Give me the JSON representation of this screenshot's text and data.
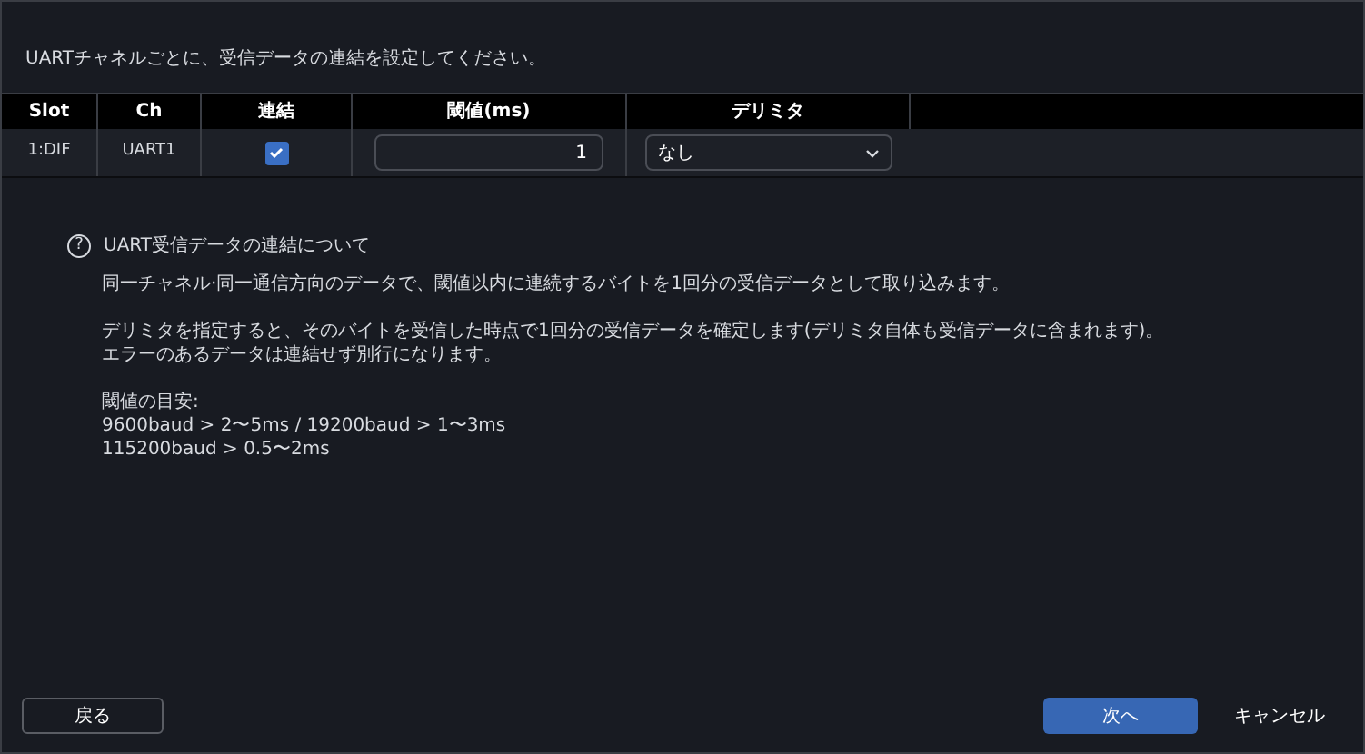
{
  "instruction": "UARTチャネルごとに、受信データの連結を設定してください。",
  "table": {
    "columns": [
      "Slot",
      "Ch",
      "連結",
      "閾値(ms)",
      "デリミタ"
    ],
    "rows": [
      {
        "slot": "1:DIF",
        "ch": "UART1",
        "checked": true,
        "threshold": "1",
        "delimiter": "なし"
      }
    ]
  },
  "info": {
    "icon": "?",
    "title": "UART受信データの連結について",
    "paragraphs": [
      [
        "同一チャネル·同一通信方向のデータで、閾値以内に連続するバイトを1回分の受信データとして取り込みます。"
      ],
      [
        "デリミタを指定すると、そのバイトを受信した時点で1回分の受信データを確定します(デリミタ自体も受信データに含まれます)。",
        "エラーのあるデータは連結せず別行になります。"
      ],
      [
        "閾値の目安:",
        "9600baud > 2〜5ms / 19200baud > 1〜3ms",
        "115200baud > 0.5〜2ms"
      ]
    ]
  },
  "buttons": {
    "back": "戻る",
    "next": "次へ",
    "cancel": "キャンセル"
  }
}
